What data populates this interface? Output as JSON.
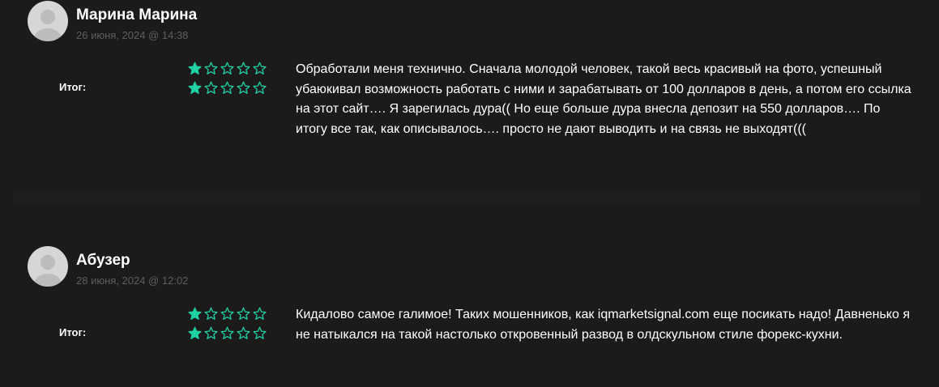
{
  "colors": {
    "background": "#1b1b1c",
    "star_accent": "#1fd1a3",
    "date_text": "#5d5d5f"
  },
  "reviews": [
    {
      "author": "Марина Марина",
      "date": "26 июня, 2024 @ 14:38",
      "label": "Итог:",
      "ratings": [
        1,
        1
      ],
      "max_rating": 5,
      "text": "Обработали меня технично. Сначала молодой человек, такой весь красивый на фото, успешный убаюкивал возможность работать с ними и зарабатывать от 100 долларов в день, а потом его ссылка на этот сайт…. Я зарегилась дура(( Но еще больше дура внесла депозит на 550 долларов…. По итогу все так, как описывалось…. просто не дают выводить и на связь не выходят((("
    },
    {
      "author": "Абузер",
      "date": "28 июня, 2024 @ 12:02",
      "label": "Итог:",
      "ratings": [
        1,
        1
      ],
      "max_rating": 5,
      "text": "Кидалово самое галимое! Таких мошенников, как iqmarketsignal.com еще посикать надо! Давненько я не натыкался на такой настолько откровенный развод в олдскульном стиле форекс-кухни."
    }
  ]
}
